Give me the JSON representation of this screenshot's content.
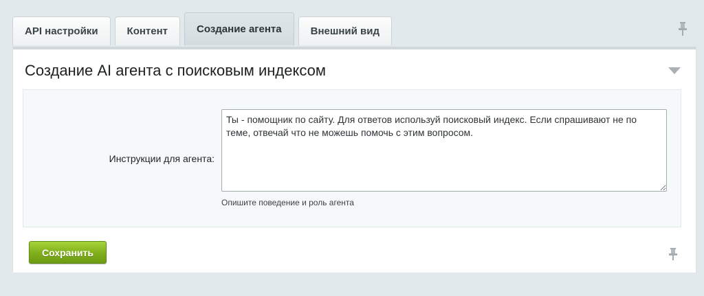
{
  "tabs": [
    {
      "label": "API настройки",
      "active": false
    },
    {
      "label": "Контент",
      "active": false
    },
    {
      "label": "Создание агента",
      "active": true
    },
    {
      "label": "Внешний вид",
      "active": false
    }
  ],
  "section": {
    "title": "Создание AI агента с поисковым индексом"
  },
  "form": {
    "instructions_label": "Инструкции для агента:",
    "instructions_value": "Ты - помощник по сайту. Для ответов используй поисковый индекс. Если спрашивают не по теме, отвечай что не можешь помочь с этим вопросом.",
    "instructions_hint": "Опишите поведение и роль агента"
  },
  "actions": {
    "save_label": "Сохранить"
  },
  "icons": {
    "tab_pin": "pin-icon",
    "collapse": "triangle-down-icon",
    "bottom_pin": "pin-icon"
  },
  "colors": {
    "background": "#e2e9ec",
    "save_button": "#7fae1b",
    "active_tab": "#d8e0e3"
  }
}
